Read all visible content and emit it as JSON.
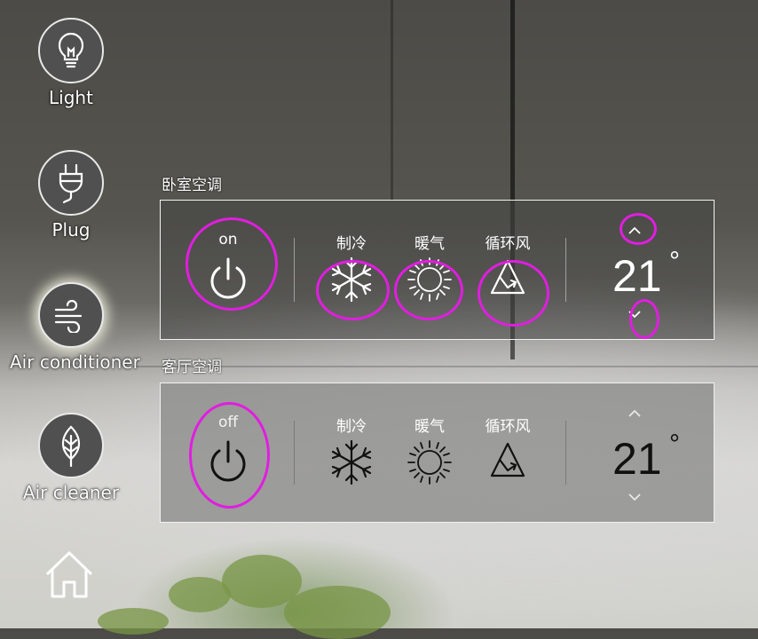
{
  "colors": {
    "annotation": "#e01ee0",
    "panel_border": "#f2f2f2",
    "text_light": "#ffffff",
    "text_dark": "#111111"
  },
  "sidebar": {
    "items": [
      {
        "label": "Light",
        "icon": "lightbulb-icon",
        "active": false
      },
      {
        "label": "Plug",
        "icon": "plug-icon",
        "active": false
      },
      {
        "label": "Air conditioner",
        "icon": "wind-icon",
        "active": true
      },
      {
        "label": "Air cleaner",
        "icon": "leaf-icon",
        "active": false
      }
    ],
    "home_icon": "home-icon"
  },
  "panels": [
    {
      "title": "卧室空调",
      "power_state": "on",
      "modes": [
        {
          "label": "制冷",
          "icon": "snowflake-icon"
        },
        {
          "label": "暖气",
          "icon": "sun-icon"
        },
        {
          "label": "循环风",
          "icon": "recycle-icon"
        }
      ],
      "temperature": "21",
      "degree_symbol": "°"
    },
    {
      "title": "客厅空调",
      "power_state": "off",
      "modes": [
        {
          "label": "制冷",
          "icon": "snowflake-icon"
        },
        {
          "label": "暖气",
          "icon": "sun-icon"
        },
        {
          "label": "循环风",
          "icon": "recycle-icon"
        }
      ],
      "temperature": "21",
      "degree_symbol": "°"
    }
  ]
}
